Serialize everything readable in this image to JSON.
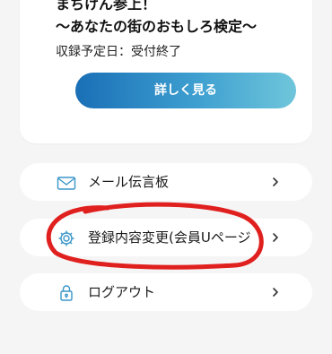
{
  "event_card": {
    "title_line1": "まちけん参上！",
    "title_line2": "〜あなたの街のおもしろ検定〜",
    "record_label": "収録予定日：受付終了",
    "detail_button_label": "詳しく見る"
  },
  "menu": {
    "items": [
      {
        "label": "メール伝言板",
        "icon": "mail-icon"
      },
      {
        "label": "登録内容変更(会員Uページ",
        "icon": "gear-icon"
      },
      {
        "label": "ログアウト",
        "icon": "lock-icon"
      }
    ]
  },
  "colors": {
    "accent": "#3a96c8",
    "icon": "#3a96c8",
    "annotation": "#e0201e",
    "background": "#f5f5f5"
  }
}
